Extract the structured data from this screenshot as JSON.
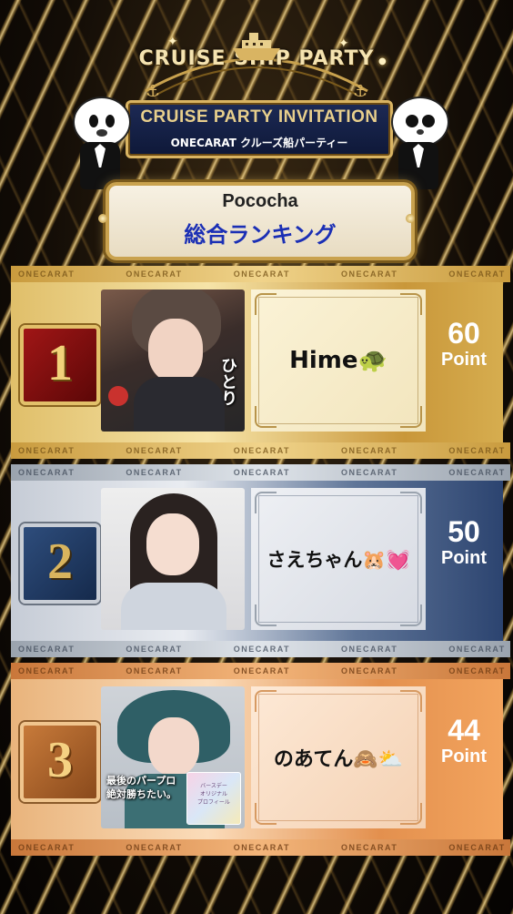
{
  "header": {
    "arc_title": "CRUISE SHIP PARTY",
    "ribbon_title": "CRUISE PARTY INVITATION",
    "ribbon_subtitle": "ONECARAT クルーズ船パーティー"
  },
  "logo_card": {
    "brand": "Pococha",
    "title": "総合ランキング"
  },
  "strip_label": "ONECARAT",
  "rankings": [
    {
      "rank": "1",
      "name": "Hime🐢",
      "points": "60",
      "unit": "Point",
      "photo_caption": "ひとり"
    },
    {
      "rank": "2",
      "name": "さえちゃん🐹💓",
      "points": "50",
      "unit": "Point"
    },
    {
      "rank": "3",
      "name": "のあてん🙈⛅",
      "points": "44",
      "unit": "Point",
      "photo_caption": "最後のパープロ\n絶対勝ちたい。",
      "photo_card": "バースデー\nオリジナル\nプロフィール"
    }
  ],
  "colors": {
    "gold": "#d6ad4f",
    "silver": "#b9c1cc",
    "navy": "#2c4470",
    "bronze": "#e59a55",
    "ranking_title": "#1b2fb5"
  }
}
